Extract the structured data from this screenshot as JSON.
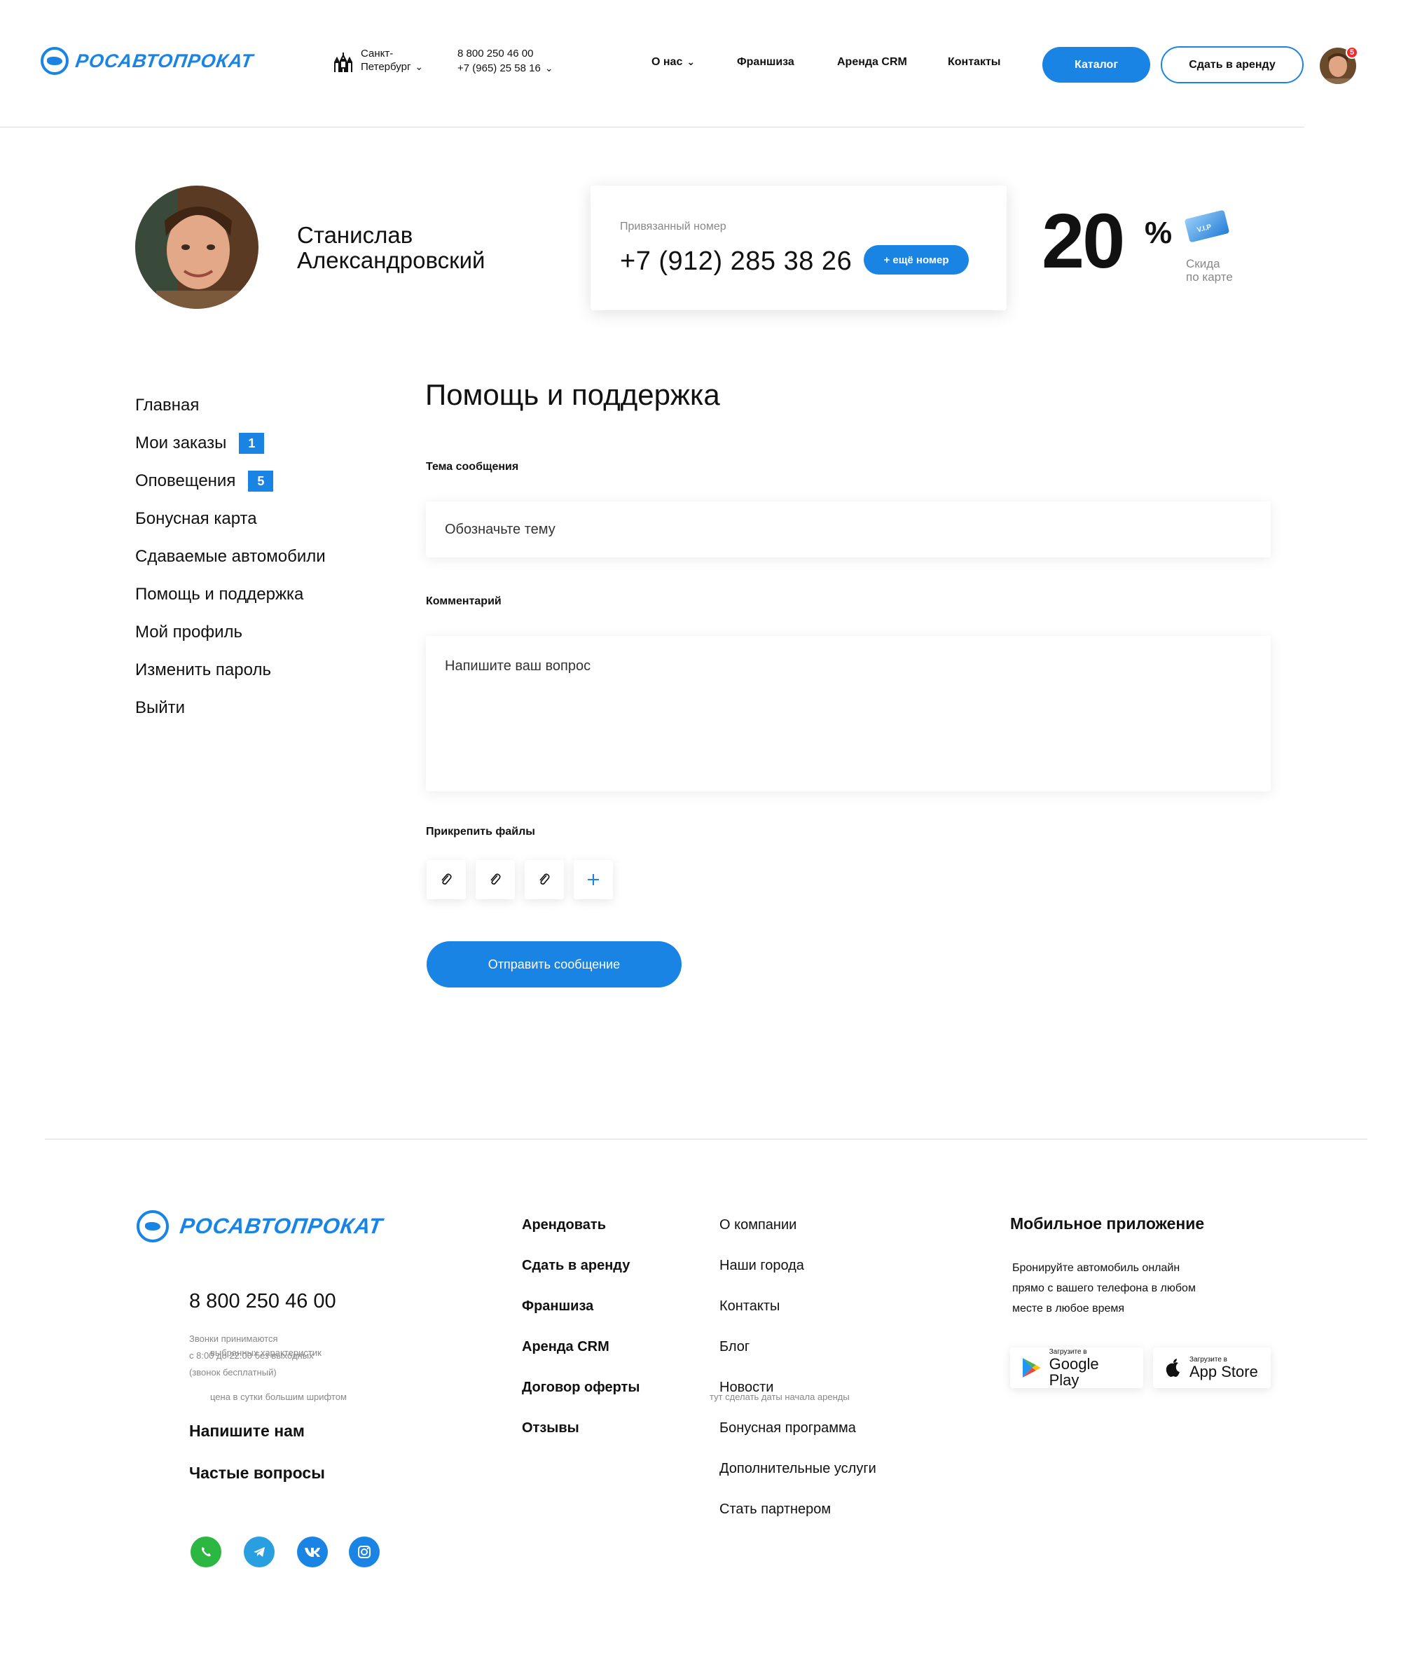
{
  "header": {
    "logo_text": "РОСАВТОПРОКАТ",
    "city": {
      "line1": "Санкт-",
      "line2": "Петербург"
    },
    "phones": [
      "8 800 250 46 00",
      "+7 (965) 25 58 16"
    ],
    "nav": [
      {
        "label": "О нас",
        "has_dropdown": true
      },
      {
        "label": "Франшиза"
      },
      {
        "label": "Аренда CRM"
      },
      {
        "label": "Контакты"
      }
    ],
    "catalog_button": "Каталог",
    "rent_out_button": "Сдать в аренду",
    "notification_count": "5"
  },
  "profile": {
    "name_line1": "Станислав",
    "name_line2": "Александровский",
    "linked_phone_label": "Привязанный номер",
    "linked_phone": "+7 (912) 285 38 26",
    "add_phone_button": "+ ещё номер",
    "discount_value": "20",
    "discount_unit": "%",
    "card_label": "V.I.P",
    "discount_caption_line1": "Скида",
    "discount_caption_line2": "по карте"
  },
  "sidebar": {
    "items": [
      {
        "label": "Главная"
      },
      {
        "label": "Мои заказы",
        "badge": "1"
      },
      {
        "label": "Оповещения",
        "badge": "5"
      },
      {
        "label": "Бонусная карта"
      },
      {
        "label": "Сдаваемые автомобили"
      },
      {
        "label": "Помощь и поддержка"
      },
      {
        "label": "Мой профиль"
      },
      {
        "label": "Изменить пароль"
      },
      {
        "label": "Выйти"
      }
    ]
  },
  "support_form": {
    "title": "Помощь и поддержка",
    "subject_label": "Тема сообщения",
    "subject_placeholder": "Обозначьте тему",
    "comment_label": "Комментарий",
    "comment_placeholder": "Напишите ваш вопрос",
    "attach_label": "Прикрепить файлы",
    "submit_button": "Отправить сообщение"
  },
  "footer": {
    "logo_text": "РОСАВТОПРОКАТ",
    "phone": "8 800 250 46 00",
    "hours_line1": "Звонки принимаются",
    "hours_line2": "с 8:00 до 22:00 без выходных",
    "hours_line3": "(звонок бесплатный)",
    "overlay_note": "цена в сутки большим шрифтом",
    "overlay_note2": "тут сделать даты начала аренды",
    "overlay_note3": "выбранных характеристик",
    "write_us": "Напишите нам",
    "faq": "Частые вопросы",
    "col1": [
      "Арендовать",
      "Сдать в аренду",
      "Франшиза",
      "Аренда CRM",
      "Договор оферты",
      "Отзывы"
    ],
    "col2": [
      "О компании",
      "Наши города",
      "Контакты",
      "Блог",
      "Новости",
      "Бонусная программа",
      "Дополнительные услуги",
      "Стать партнером"
    ],
    "app_title": "Мобильное приложение",
    "app_text_line1": "Бронируйте автомобиль онлайн",
    "app_text_line2": "прямо с вашего телефона в любом",
    "app_text_line3": "месте в любое время",
    "google_small": "Загрузите в",
    "google_big": "Google Play",
    "apple_small": "Загрузите в",
    "apple_big": "App Store"
  },
  "colors": {
    "accent": "#1a84e5",
    "badge_red": "#f02b2b"
  }
}
